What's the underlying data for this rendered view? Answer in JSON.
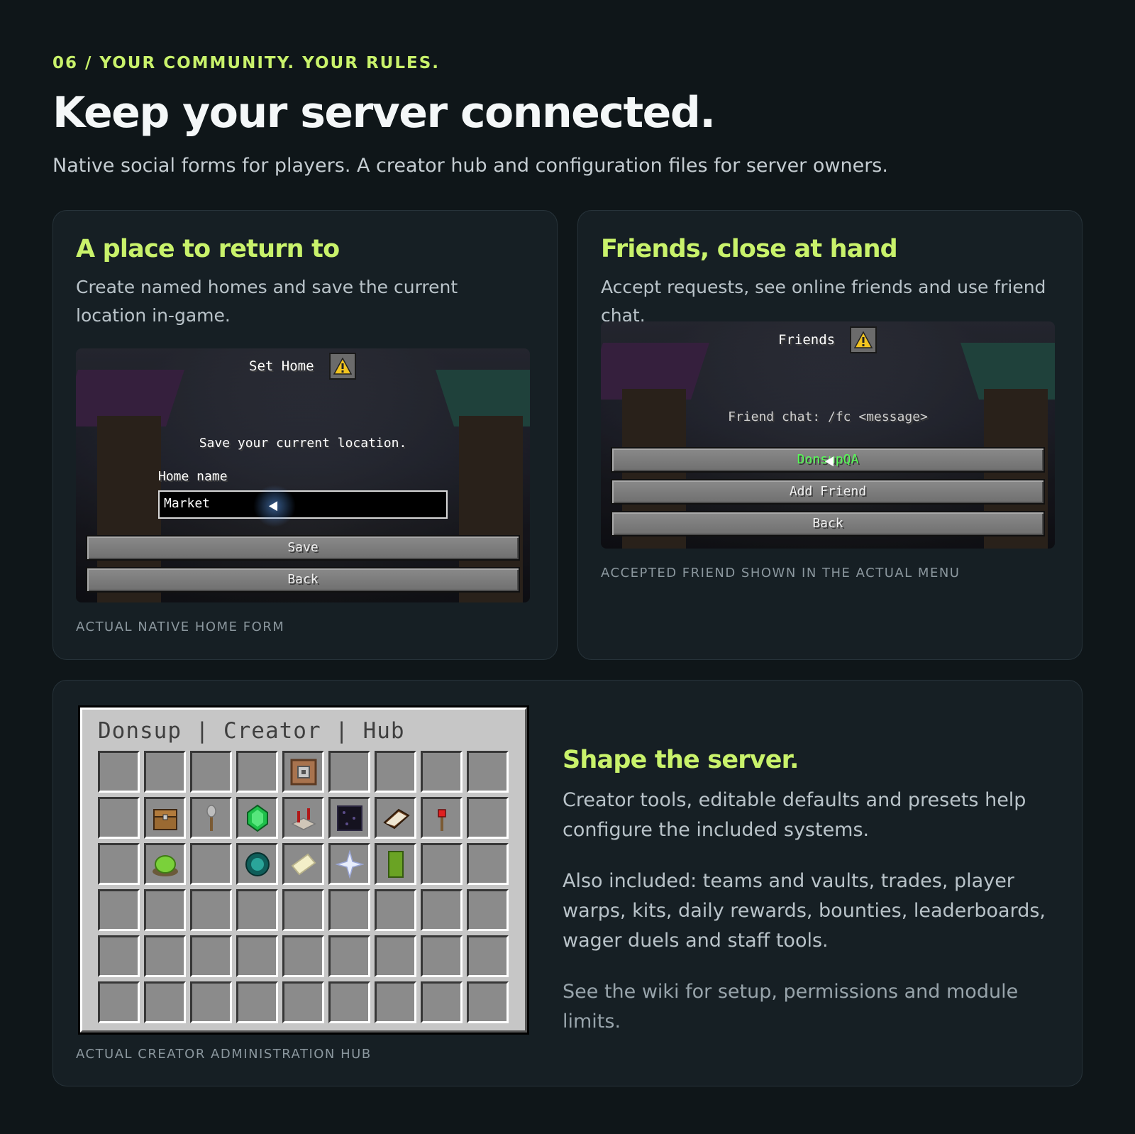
{
  "header": {
    "eyebrow": "06 / YOUR COMMUNITY. YOUR RULES.",
    "title": "Keep your server connected.",
    "subtitle": "Native social forms for players. A creator hub and configuration files for server owners."
  },
  "home_card": {
    "heading": "A place to return to",
    "description": "Create named homes and save the current location in-game.",
    "screen": {
      "title": "Set Home",
      "prompt": "Save your current location.",
      "field_label": "Home name",
      "field_value": "Market",
      "save_label": "Save",
      "back_label": "Back"
    },
    "caption": "ACTUAL NATIVE HOME FORM"
  },
  "friends_card": {
    "heading": "Friends, close at hand",
    "description": "Accept requests, see online friends and use friend chat.",
    "screen": {
      "title": "Friends",
      "hint": "Friend chat: /fc <message>",
      "friend_label": "DonsupQA",
      "add_label": "Add Friend",
      "back_label": "Back"
    },
    "caption": "ACCEPTED FRIEND SHOWN IN THE ACTUAL MENU"
  },
  "hub_card": {
    "hub_title": "Donsup | Creator | Hub",
    "caption": "ACTUAL CREATOR ADMINISTRATION HUB",
    "heading": "Shape the server.",
    "paragraph_1": "Creator tools, editable defaults and presets help configure the included systems.",
    "paragraph_2": "Also included: teams and vaults, trades, player warps, kits, daily rewards, bounties, leaderboards, wager duels and staff tools.",
    "paragraph_3": "See the wiki for setup, permissions and module limits.",
    "slots": [
      "",
      "",
      "",
      "",
      "command-block-icon",
      "",
      "",
      "",
      "",
      "",
      "chest-icon",
      "shovel-icon",
      "emerald-icon",
      "redstone-repeater-icon",
      "obsidian-icon",
      "book-icon",
      "redstone-torch-icon",
      "",
      "",
      "slime-block-icon",
      "",
      "ender-pearl-icon",
      "paper-icon",
      "nether-star-icon",
      "green-banner-icon",
      "",
      "",
      "",
      "",
      "",
      "",
      "",
      "",
      "",
      "",
      "",
      "",
      "",
      "",
      "",
      "",
      "",
      "",
      "",
      "",
      "",
      "",
      "",
      "",
      "",
      "",
      "",
      "",
      ""
    ]
  },
  "colors": {
    "accent": "#c9f26b",
    "background": "#0f1619",
    "card": "#161f24",
    "friend_online": "#55ff55"
  }
}
